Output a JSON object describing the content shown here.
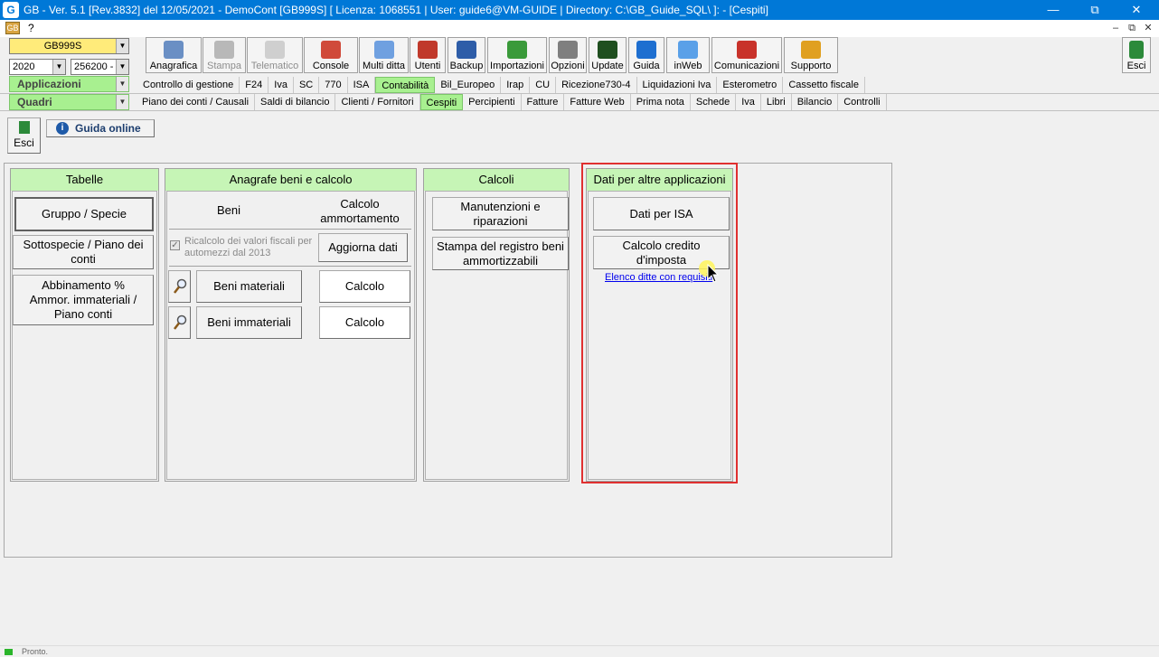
{
  "window": {
    "app_icon": "G",
    "title": "GB - Ver. 5.1 [Rev.3832] del 12/05/2021 - DemoCont [GB999S]   [ Licenza: 1068551 | User: guide6@VM-GUIDE | Directory: C:\\GB_Guide_SQL\\ ]: - [Cespiti]",
    "minimize": "—",
    "restore": "⧉",
    "close": "✕"
  },
  "menu": {
    "help": "?",
    "mdi_icon": "GB",
    "mdi_min": "–",
    "mdi_restore": "⧉",
    "mdi_close": "✕"
  },
  "selectors": {
    "company": "GB999S",
    "year": "2020",
    "code": "256200 -",
    "arrow": "▼"
  },
  "toolbar": [
    {
      "label": "Anagrafica",
      "icon": "book-icon",
      "color": "#6a8fc4"
    },
    {
      "label": "Stampa",
      "icon": "printer-icon",
      "color": "#b8b8b8"
    },
    {
      "label": "Telematico",
      "icon": "document-send-icon",
      "color": "#cfcfcf"
    },
    {
      "label": "Console",
      "icon": "monitor-icon",
      "color": "#d04a3a"
    },
    {
      "label": "Multi ditta",
      "icon": "network-icon",
      "color": "#6fa0e0"
    },
    {
      "label": "Utenti",
      "icon": "users-icon",
      "color": "#c0392b"
    },
    {
      "label": "Backup",
      "icon": "server-icon",
      "color": "#2e5da8"
    },
    {
      "label": "Importazioni",
      "icon": "import-icon",
      "color": "#3a9a3a"
    },
    {
      "label": "Opzioni",
      "icon": "wrench-icon",
      "color": "#7f7f7f"
    },
    {
      "label": "Update",
      "icon": "activity-icon",
      "color": "#1f4f1f"
    },
    {
      "label": "Guida",
      "icon": "help-icon",
      "color": "#1e6fd0"
    },
    {
      "label": "inWeb",
      "icon": "cloud-icon",
      "color": "#5aa0e8"
    },
    {
      "label": "Comunicazioni",
      "icon": "gift-icon",
      "color": "#c8322a"
    },
    {
      "label": "Supporto",
      "icon": "support-icon",
      "color": "#e0a020"
    }
  ],
  "exit_top": {
    "label": "Esci"
  },
  "applicazioni": {
    "label": "Applicazioni",
    "items": [
      "Controllo di gestione",
      "F24",
      "Iva",
      "SC",
      "770",
      "ISA",
      "Contabilità",
      "Bil_Europeo",
      "Irap",
      "CU",
      "Ricezione730-4",
      "Liquidazioni Iva",
      "Esterometro",
      "Cassetto fiscale"
    ],
    "active": "Contabilità"
  },
  "quadri": {
    "label": "Quadri",
    "items": [
      "Piano dei conti / Causali",
      "Saldi di bilancio",
      "Clienti / Fornitori",
      "Cespiti",
      "Percipienti",
      "Fatture",
      "Fatture Web",
      "Prima nota",
      "Schede",
      "Iva",
      "Libri",
      "Bilancio",
      "Controlli"
    ],
    "active": "Cespiti"
  },
  "page": {
    "exit_label": "Esci",
    "guide_label": "Guida online",
    "guide_icon": "i"
  },
  "tabelle": {
    "title": "Tabelle",
    "buttons": [
      "Gruppo / Specie",
      "Sottospecie / Piano dei conti",
      "Abbinamento % Ammor. immateriali / Piano conti"
    ]
  },
  "anagrafe": {
    "title": "Anagrafe beni e calcolo",
    "col_beni": "Beni",
    "col_calcolo": "Calcolo ammortamento",
    "checkbox_label": "Ricalcolo dei valori fiscali per automezzi dal 2013",
    "checkbox_checked": true,
    "aggiorna": "Aggiorna dati",
    "rows": [
      {
        "beni": "Beni materiali",
        "calcolo": "Calcolo"
      },
      {
        "beni": "Beni immateriali",
        "calcolo": "Calcolo"
      }
    ]
  },
  "calcoli": {
    "title": "Calcoli",
    "buttons": [
      "Manutenzioni e riparazioni",
      "Stampa del registro beni ammortizzabili"
    ]
  },
  "dati_altre": {
    "title": "Dati per altre applicazioni",
    "buttons": [
      "Dati per ISA",
      "Calcolo credito d'imposta"
    ],
    "link": "Elenco ditte con requisiti",
    "highlight_color": "#e03030"
  },
  "status": {
    "text": "Pronto."
  }
}
